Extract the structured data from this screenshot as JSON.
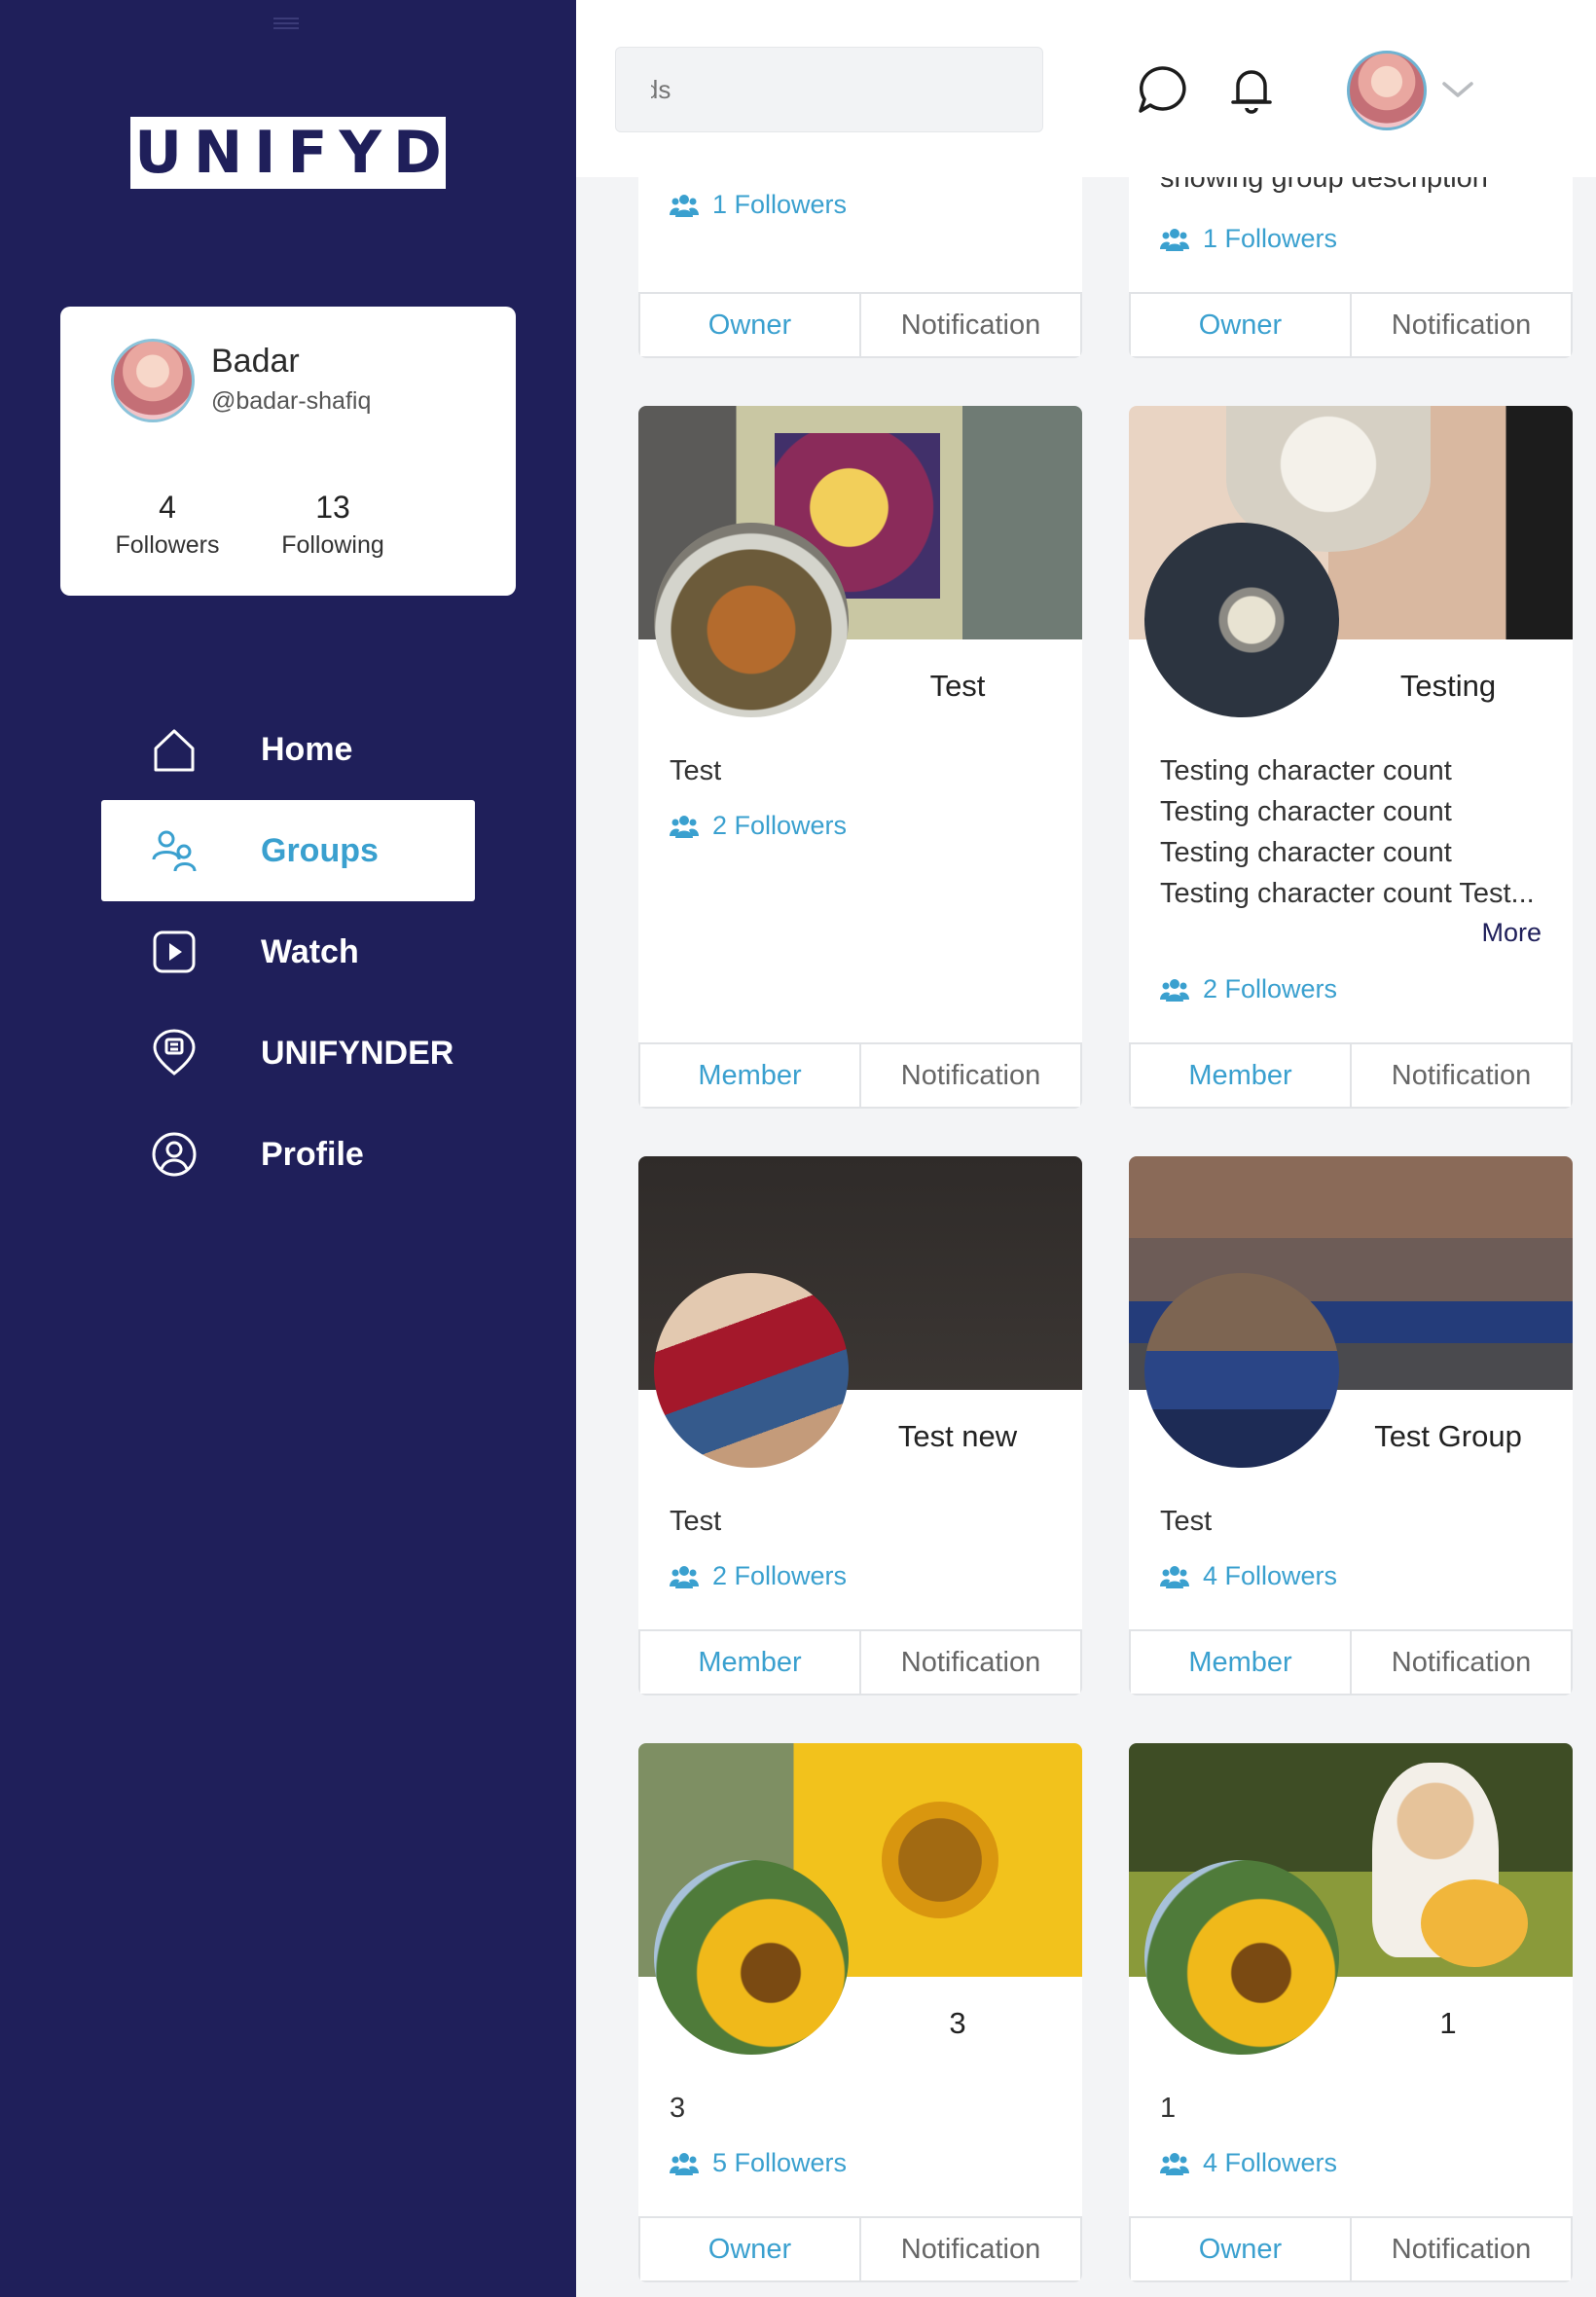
{
  "sidebar": {
    "logo_text": "UNIFYD",
    "profile": {
      "name": "Badar",
      "handle": "@badar-shafiq",
      "followers_count": "4",
      "followers_label": "Followers",
      "following_count": "13",
      "following_label": "Following"
    },
    "nav": [
      {
        "label": "Home",
        "icon": "home-icon",
        "active": false
      },
      {
        "label": "Groups",
        "icon": "groups-icon",
        "active": true
      },
      {
        "label": "Watch",
        "icon": "watch-icon",
        "active": false
      },
      {
        "label": "UNIFYNDER",
        "icon": "unifynder-icon",
        "active": false
      },
      {
        "label": "Profile",
        "icon": "profile-icon",
        "active": false
      }
    ]
  },
  "topbar": {
    "search_placeholder": "ends",
    "icons": [
      "chat-icon",
      "bell-icon",
      "avatar",
      "chevron-down-icon"
    ]
  },
  "colors": {
    "sidebar_bg": "#1f1f5a",
    "accent": "#3aa0cf",
    "page_bg": "#f3f4f6"
  },
  "groups": [
    {
      "title": "",
      "desc": "",
      "followers": "1 Followers",
      "role": "Owner",
      "notif": "Notification"
    },
    {
      "title": "",
      "desc": "showing group description",
      "followers": "1 Followers",
      "role": "Owner",
      "notif": "Notification"
    },
    {
      "title": "Test",
      "desc": "Test",
      "followers": "2 Followers",
      "role": "Member",
      "notif": "Notification"
    },
    {
      "title": "Testing",
      "desc": "Testing character count Testing character count Testing character count Testing character count Test...",
      "more": "More",
      "followers": "2 Followers",
      "role": "Member",
      "notif": "Notification"
    },
    {
      "title": "Test new",
      "desc": "Test",
      "followers": "2 Followers",
      "role": "Member",
      "notif": "Notification"
    },
    {
      "title": "Test Group",
      "desc": "Test",
      "followers": "4 Followers",
      "role": "Member",
      "notif": "Notification"
    },
    {
      "title": "3",
      "desc": "3",
      "followers": "5 Followers",
      "role": "Owner",
      "notif": "Notification"
    },
    {
      "title": "1",
      "desc": "1",
      "followers": "4 Followers",
      "role": "Owner",
      "notif": "Notification"
    }
  ]
}
